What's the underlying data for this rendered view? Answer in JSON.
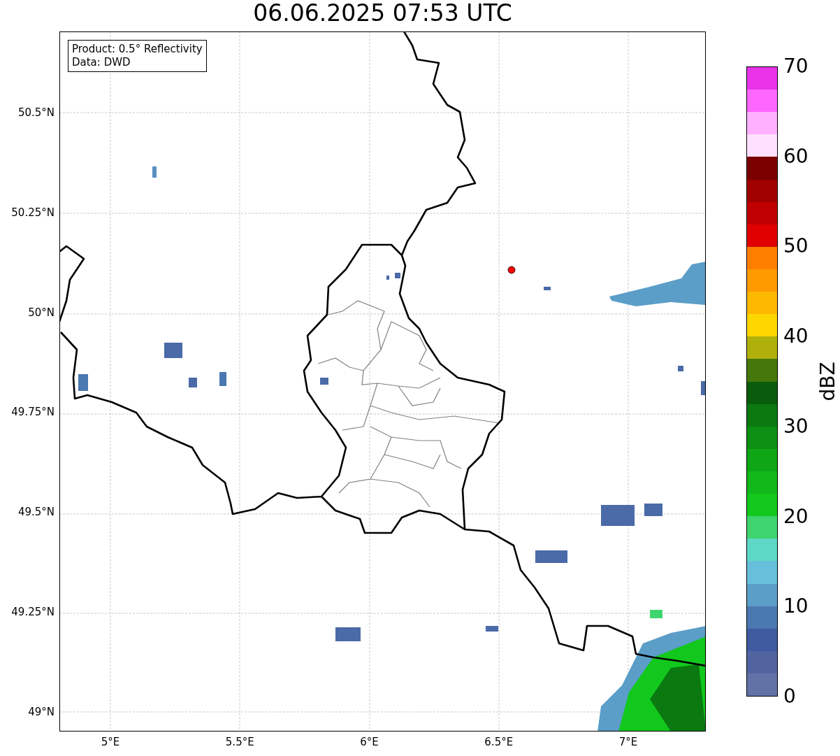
{
  "title": "06.06.2025 07:53 UTC",
  "info_box": [
    "Product: 0.5° Reflectivity",
    "Data: DWD"
  ],
  "map": {
    "lon_ticks": [
      "5°E",
      "5.5°E",
      "6°E",
      "6.5°E",
      "7°E"
    ],
    "lat_ticks": [
      "50.5°N",
      "50.25°N",
      "50°N",
      "49.75°N",
      "49.5°N",
      "49.25°N",
      "49°N"
    ]
  },
  "colorbar": {
    "label": "dBZ",
    "ticks": [
      "70",
      "60",
      "50",
      "40",
      "30",
      "20",
      "10",
      "0"
    ],
    "bands": [
      {
        "color": "#6272a6"
      },
      {
        "color": "#5264a0"
      },
      {
        "color": "#405aa0"
      },
      {
        "color": "#4a78b0"
      },
      {
        "color": "#5b9ec8"
      },
      {
        "color": "#66c0dc"
      },
      {
        "color": "#5ed8c6"
      },
      {
        "color": "#3ed46e"
      },
      {
        "color": "#12c81c"
      },
      {
        "color": "#10b81a"
      },
      {
        "color": "#0ea614"
      },
      {
        "color": "#0c8f12"
      },
      {
        "color": "#0a7a10"
      },
      {
        "color": "#085c0c"
      },
      {
        "color": "#45770c"
      },
      {
        "color": "#b0b00a"
      },
      {
        "color": "#ffd700"
      },
      {
        "color": "#ffb800"
      },
      {
        "color": "#ff9a00"
      },
      {
        "color": "#ff7e00"
      },
      {
        "color": "#e00000"
      },
      {
        "color": "#c00000"
      },
      {
        "color": "#a00000"
      },
      {
        "color": "#7a0000"
      },
      {
        "color": "#ffe0ff"
      },
      {
        "color": "#ffb0ff"
      },
      {
        "color": "#ff66ff"
      },
      {
        "color": "#e833e8"
      }
    ]
  }
}
